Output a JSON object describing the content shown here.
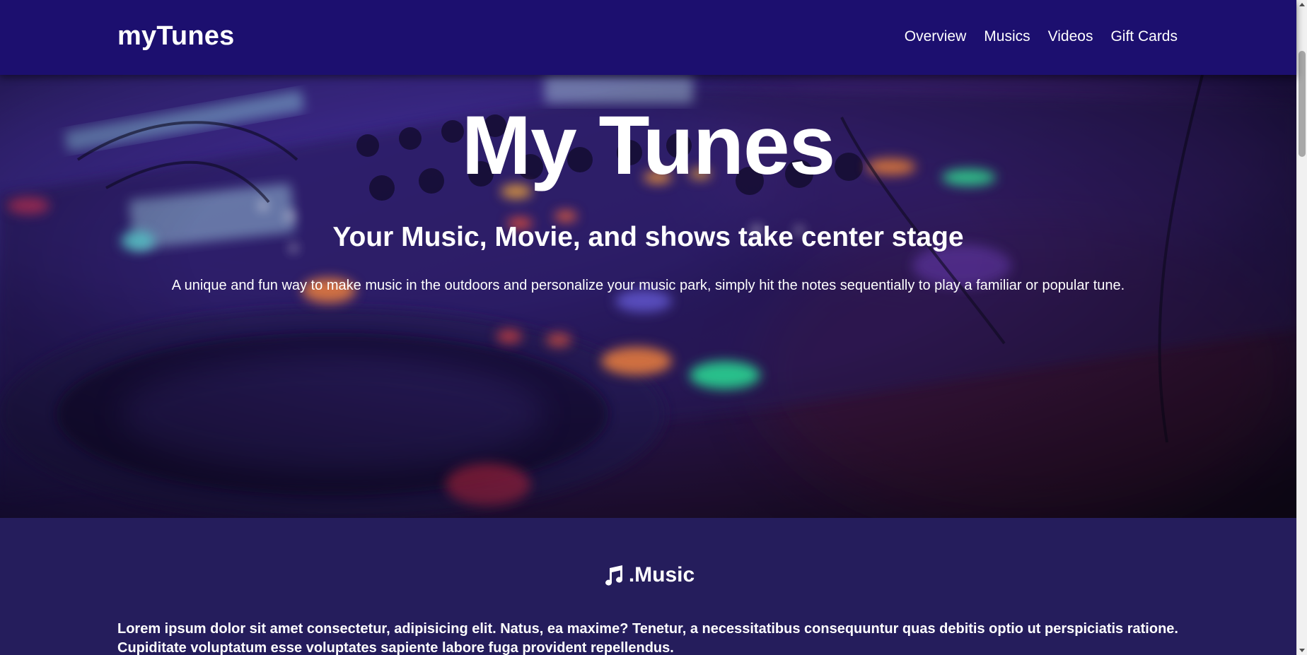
{
  "navbar": {
    "brand": "myTunes",
    "links": [
      "Overview",
      "Musics",
      "Videos",
      "Gift Cards"
    ]
  },
  "hero": {
    "title": "My Tunes",
    "subtitle": "Your Music, Movie, and shows take center stage",
    "text": "A unique and fun way to make music in the outdoors and personalize your music park, simply hit the notes sequentially to play a familiar or popular tune."
  },
  "music": {
    "icon": "music-note-icon",
    "heading": ".Music",
    "text": "Lorem ipsum dolor sit amet consectetur, adipisicing elit. Natus, ea maxime? Tenetur, a necessitatibus consequuntur quas debitis optio ut perspiciatis ratione. Cupiditate voluptatum esse voluptates sapiente labore fuga provident repellendus."
  },
  "colors": {
    "navbar": "#1c0f6f",
    "section_bg": "#251d5c",
    "text": "#ffffff"
  }
}
